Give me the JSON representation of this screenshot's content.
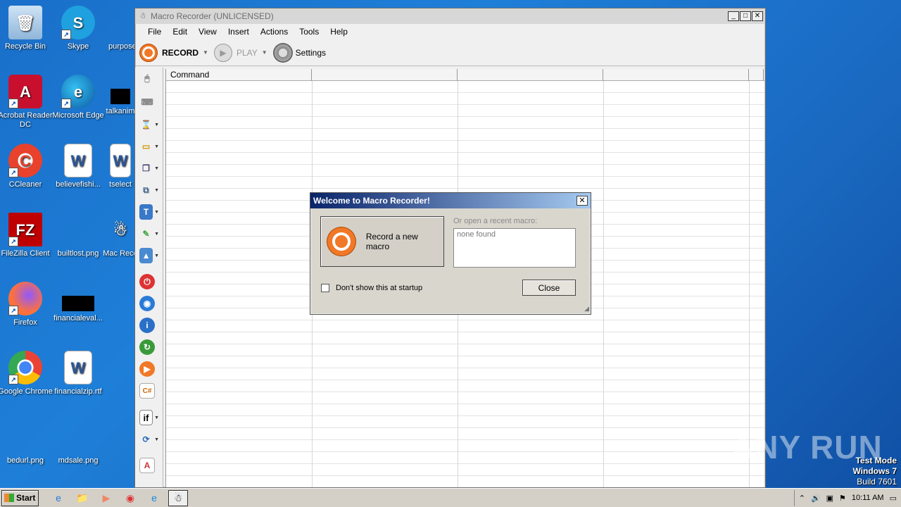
{
  "desktop": {
    "icons": [
      {
        "label": "Recycle Bin",
        "icon": "recycle-bin-icon"
      },
      {
        "label": "Skype",
        "icon": "skype-icon"
      },
      {
        "label": "purpose",
        "icon": "file-icon"
      },
      {
        "label": "Acrobat Reader DC",
        "icon": "acrobat-icon"
      },
      {
        "label": "Microsoft Edge",
        "icon": "edge-icon"
      },
      {
        "label": "talkanim",
        "icon": "file-icon"
      },
      {
        "label": "CCleaner",
        "icon": "ccleaner-icon"
      },
      {
        "label": "believefishi...",
        "icon": "word-doc-icon"
      },
      {
        "label": "tselect",
        "icon": "word-doc-icon"
      },
      {
        "label": "FileZilla Client",
        "icon": "filezilla-icon"
      },
      {
        "label": "builtlost.png",
        "icon": "image-file-icon"
      },
      {
        "label": "Mac Reco",
        "icon": "macro-recorder-icon"
      },
      {
        "label": "Firefox",
        "icon": "firefox-icon"
      },
      {
        "label": "financialeval...",
        "icon": "file-icon"
      },
      {
        "label": "Google Chrome",
        "icon": "chrome-icon"
      },
      {
        "label": "financialzip.rtf",
        "icon": "word-doc-icon"
      },
      {
        "label": "bedurl.png",
        "icon": "image-file-icon"
      },
      {
        "label": "mdsale.png",
        "icon": "image-file-icon"
      }
    ]
  },
  "window": {
    "title": "Macro Recorder (UNLICENSED)",
    "menu": [
      "File",
      "Edit",
      "View",
      "Insert",
      "Actions",
      "Tools",
      "Help"
    ],
    "toolbar": {
      "record_label": "RECORD",
      "play_label": "PLAY",
      "settings_label": "Settings"
    },
    "grid": {
      "columns": [
        "Command",
        "",
        "",
        ""
      ]
    }
  },
  "dialog": {
    "title": "Welcome to Macro Recorder!",
    "record_new_label": "Record a new macro",
    "recent_label": "Or open a recent macro:",
    "recent_empty": "none found",
    "dont_show_label": "Don't show this at startup",
    "close_label": "Close"
  },
  "taskbar": {
    "start_label": "Start",
    "clock": "10:11 AM"
  },
  "overlay": {
    "watermark": "ANY RUN",
    "test_mode": "Test Mode",
    "os": "Windows 7",
    "build": "Build 7601"
  },
  "colors": {
    "desktop_bg": "#1a6fc9",
    "record_orange": "#f07828",
    "dialog_title_start": "#0a246a"
  }
}
